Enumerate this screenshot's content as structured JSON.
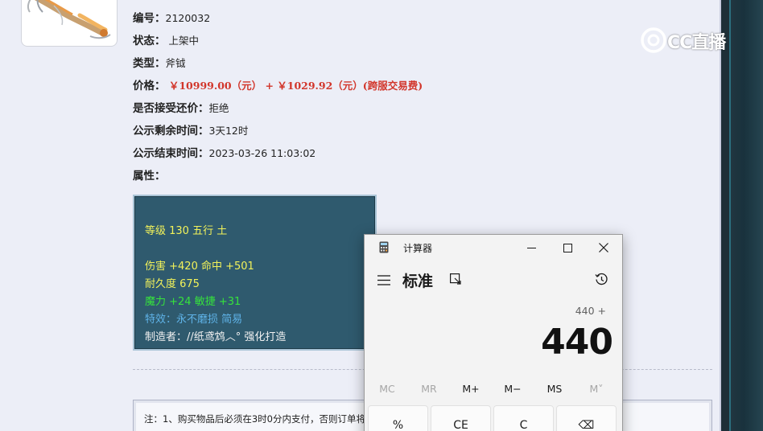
{
  "item": {
    "fields": [
      {
        "label": "编号：",
        "value": "2120032"
      },
      {
        "label": "状态：",
        "value": " 上架中"
      },
      {
        "label": "类型：",
        "value": "斧钺"
      },
      {
        "label": "价格：",
        "value": " ￥10999.00（元） +  ￥1029.92（元）(跨服交易费)"
      },
      {
        "label": "是否接受还价：",
        "value": "拒绝"
      },
      {
        "label": "公示剩余时间：",
        "value": "3天12时"
      },
      {
        "label": "公示结束时间：",
        "value": "2023-03-26 11:03:02"
      },
      {
        "label": "属性：",
        "value": ""
      }
    ],
    "attributes": [
      {
        "text": "等级 130 五行 土",
        "color": "#f2f25a"
      },
      {
        "text": "伤害 +420 命中 +501",
        "color": "#f2f25a"
      },
      {
        "text": "耐久度 675",
        "color": "#f2f25a"
      },
      {
        "text": "魔力 +24 敏捷 +31",
        "color": "#36e33c"
      },
      {
        "text": "特效：永不磨损 简易",
        "color": "#5fb3e8"
      },
      {
        "text": "制造者：//纸鸢鸩︿° 强化打造",
        "color": "#f2f2f2"
      }
    ],
    "note": "注：1、购买物品后必须在3时0分内支付，否则订单将"
  },
  "watermark": {
    "text": "CC直播"
  },
  "calculator": {
    "title": "计算器",
    "mode": "标准",
    "expression": "440 +",
    "display": "440",
    "memory_buttons": [
      "MC",
      "MR",
      "M+",
      "M−",
      "MS",
      "M˅"
    ],
    "keys": [
      "%",
      "CE",
      "C",
      "⌫"
    ]
  }
}
